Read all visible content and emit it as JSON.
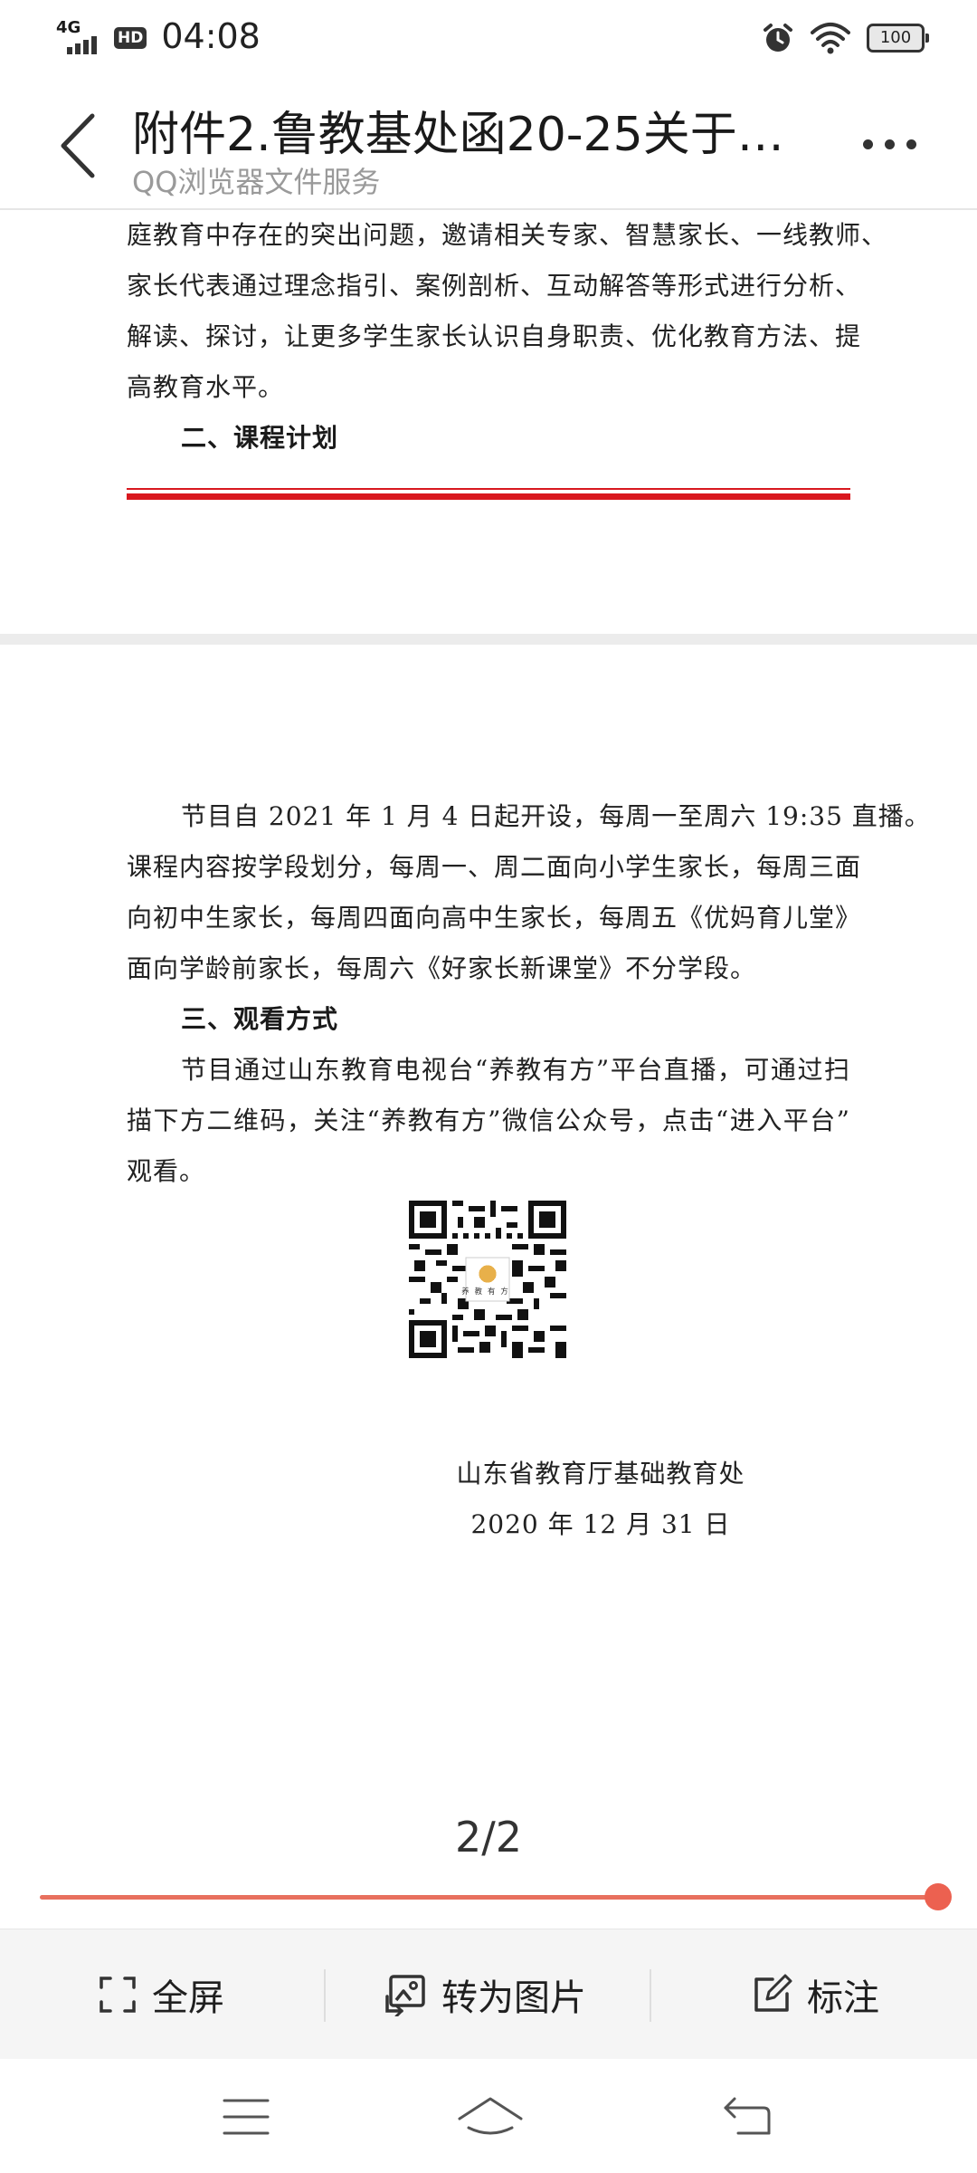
{
  "status_bar": {
    "network": "4G",
    "hd": "HD",
    "time": "04:08",
    "battery": "100"
  },
  "title_bar": {
    "title": "附件2.鲁教基处函20-25关于…",
    "subtitle": "QQ浏览器文件服务"
  },
  "document": {
    "page1_lines": [
      "庭教育中存在的突出问题，邀请相关专家、智慧家长、一线教师、",
      "家长代表通过理念指引、案例剖析、互动解答等形式进行分析、",
      "解读、探讨，让更多学生家长认识自身职责、优化教育方法、提",
      "高教育水平。"
    ],
    "section2_heading": "二、课程计划",
    "page2_para1": [
      "节目自 2021 年 1 月 4 日起开设，每周一至周六 19:35 直播。",
      "课程内容按学段划分，每周一、周二面向小学生家长，每周三面",
      "向初中生家长，每周四面向高中生家长，每周五《优妈育儿堂》",
      "面向学龄前家长，每周六《好家长新课堂》不分学段。"
    ],
    "section3_heading": "三、观看方式",
    "page2_para2": [
      "节目通过山东教育电视台“养教有方”平台直播，可通过扫",
      "描下方二维码，关注“养教有方”微信公众号，点击“进入平台”",
      "观看。"
    ],
    "qr_center_label": "养教有方",
    "signature_org": "山东省教育厅基础教育处",
    "signature_date": "2020 年 12 月 31 日"
  },
  "pager": {
    "indicator": "2/2",
    "progress": 1.0
  },
  "toolbar": {
    "fullscreen_label": "全屏",
    "to_image_label": "转为图片",
    "annotate_label": "标注"
  },
  "colors": {
    "accent": "#ec6150",
    "red_rule": "#d9181f",
    "toolbar_bg": "#f5f5f5"
  },
  "icons": [
    "back-arrow-icon",
    "more-icon",
    "fullscreen-icon",
    "image-convert-icon",
    "annotate-icon",
    "menu-icon",
    "home-icon",
    "back-icon",
    "alarm-icon",
    "wifi-icon"
  ]
}
